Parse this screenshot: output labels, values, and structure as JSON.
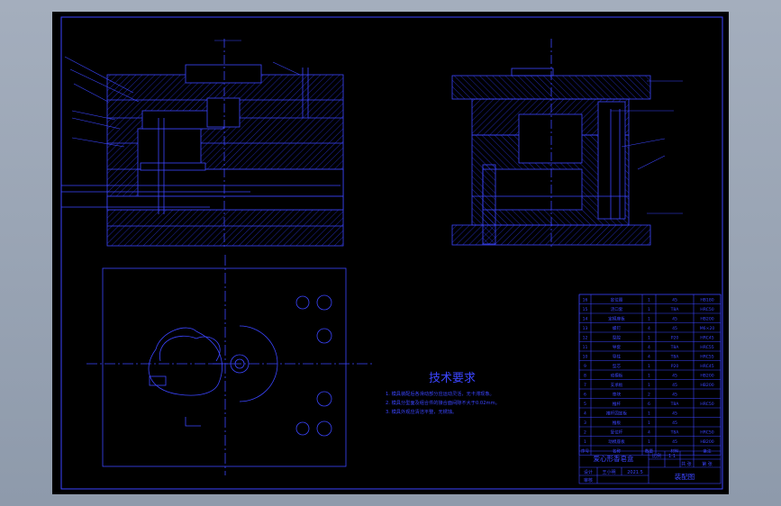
{
  "drawing": {
    "tech_title": "技术要求",
    "tech_notes": [
      "1. 模具装配后各滑动部分应运动灵活，无卡滞现象。",
      "2. 模具分型面及组合件的接合面间隙不大于0.02mm。",
      "3. 模具外观应清洁平整，无锈蚀。"
    ],
    "title_block": {
      "part_name": "爱心形香皂盒",
      "drawing_label": "装配图",
      "designer": "设计",
      "checker": "审核",
      "designer_name": "王小明",
      "date": "2021.5",
      "scale_label": "比例",
      "scale": "1:1",
      "sheet_label": "共 张",
      "sheet": "第 张"
    },
    "bom_header": [
      "序号",
      "名称",
      "数量",
      "材料",
      "备注"
    ],
    "bom_rows": [
      [
        "16",
        "定位圈",
        "1",
        "45",
        "HB180"
      ],
      [
        "15",
        "浇口套",
        "1",
        "T8A",
        "HRC50"
      ],
      [
        "14",
        "定模座板",
        "1",
        "45",
        "HB200"
      ],
      [
        "13",
        "螺钉",
        "4",
        "45",
        "M6×20"
      ],
      [
        "12",
        "型腔",
        "1",
        "P20",
        "HRC45"
      ],
      [
        "11",
        "导套",
        "4",
        "T8A",
        "HRC55"
      ],
      [
        "10",
        "导柱",
        "4",
        "T8A",
        "HRC55"
      ],
      [
        "9",
        "型芯",
        "1",
        "P20",
        "HRC45"
      ],
      [
        "8",
        "动模板",
        "1",
        "45",
        "HB200"
      ],
      [
        "7",
        "支承板",
        "1",
        "45",
        "HB200"
      ],
      [
        "6",
        "垫块",
        "2",
        "45",
        ""
      ],
      [
        "5",
        "推杆",
        "6",
        "T8A",
        "HRC50"
      ],
      [
        "4",
        "推杆固定板",
        "1",
        "45",
        ""
      ],
      [
        "3",
        "推板",
        "1",
        "45",
        ""
      ],
      [
        "2",
        "复位杆",
        "4",
        "T8A",
        "HRC50"
      ],
      [
        "1",
        "动模座板",
        "1",
        "45",
        "HB200"
      ]
    ]
  }
}
